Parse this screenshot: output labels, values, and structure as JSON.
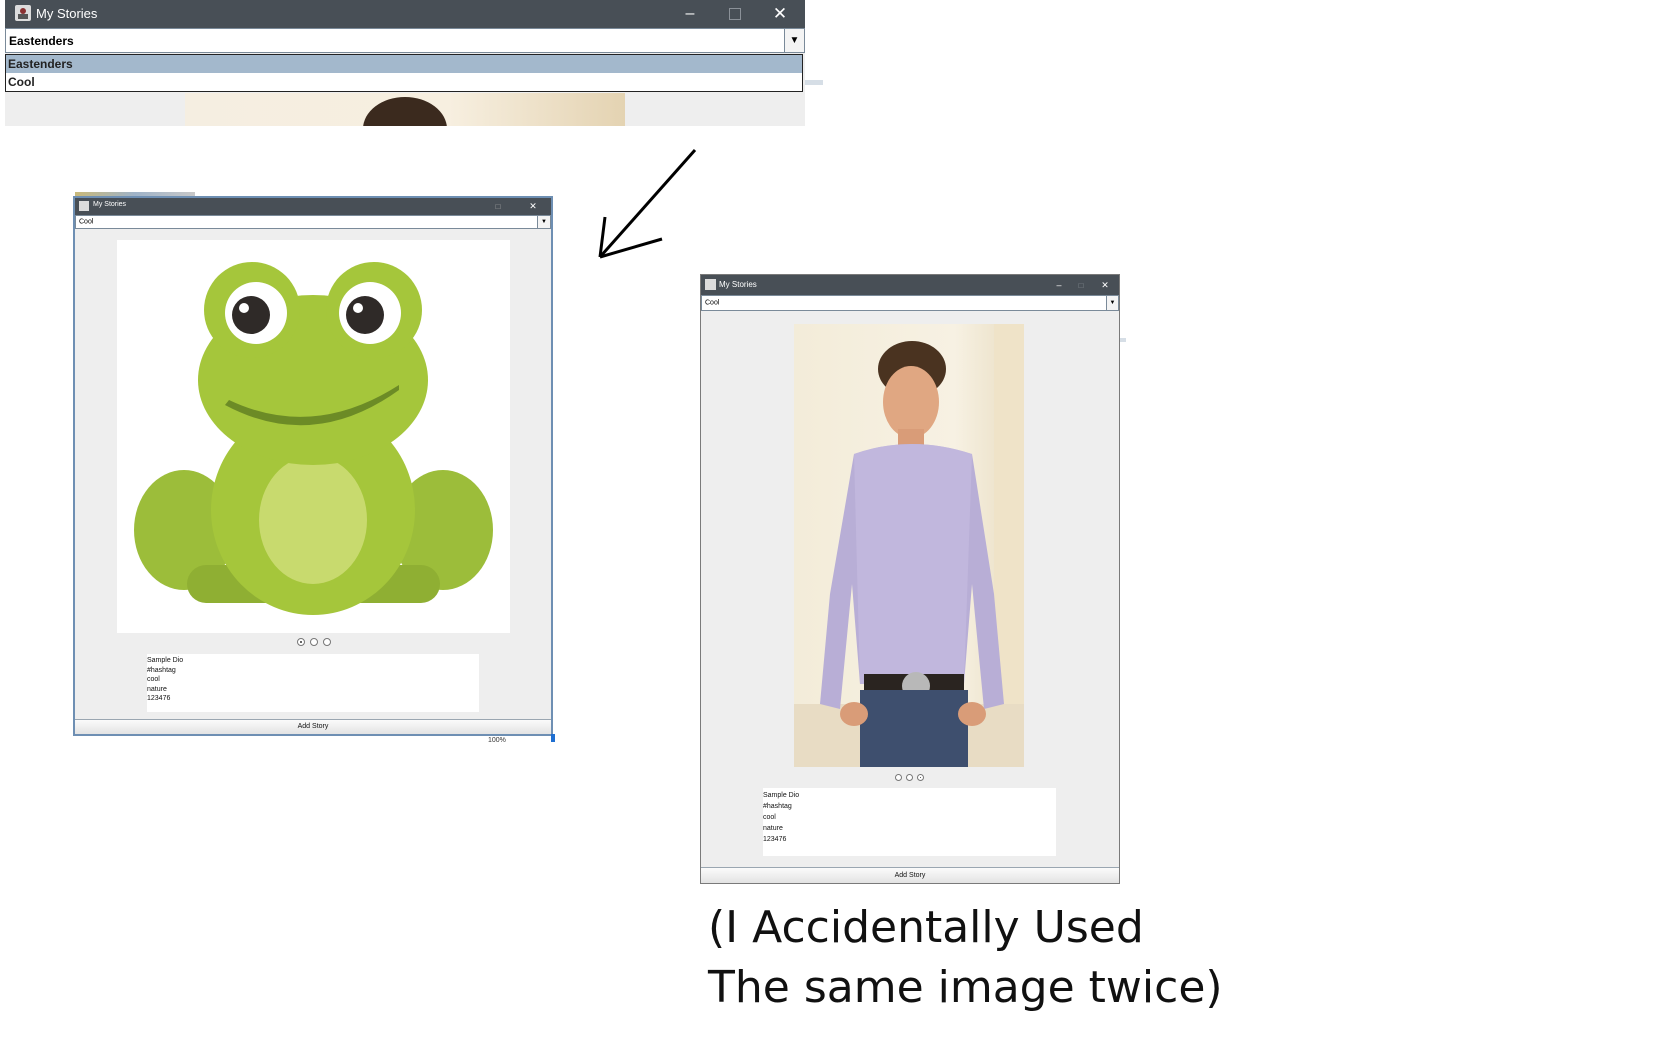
{
  "top_window": {
    "title": "My Stories",
    "combo_value": "Eastenders",
    "dropdown_options": [
      "Eastenders",
      "Cool"
    ],
    "selected_option": "Eastenders"
  },
  "frog_window": {
    "title": "My Stories",
    "combo_value": "Cool",
    "image_icon": "frog-illustration",
    "page_dots_selected": 1,
    "description": "Sample Dio\n#hashtag\ncool\nnature\n123476",
    "add_button": "Add Story",
    "zoom": "100%"
  },
  "photo_window": {
    "title": "My Stories",
    "combo_value": "Cool",
    "image_icon": "man-in-shirt-photo",
    "page_dots_selected": 3,
    "description": "Sample Dio\n#hashtag\ncool\nnature\n123476",
    "add_button": "Add Story"
  },
  "caption": {
    "line1": "(I Accidentally Used",
    "line2": "The same image twice)"
  },
  "colors": {
    "titlebar": "#484f56",
    "selection": "#a3b8cc",
    "frog_green": "#a5c63b"
  }
}
